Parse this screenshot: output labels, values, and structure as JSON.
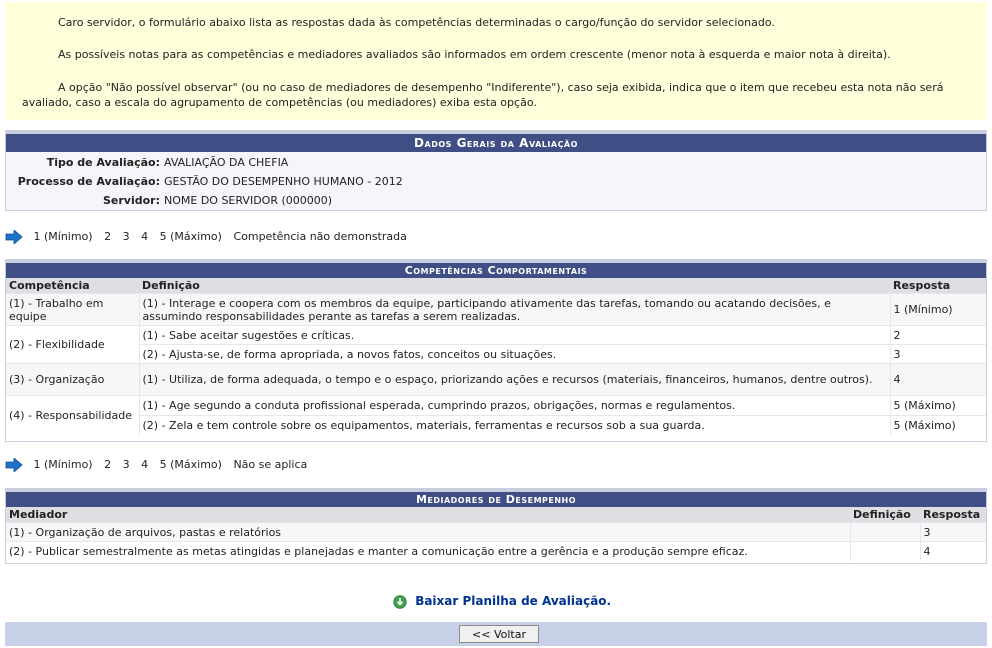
{
  "notice": {
    "p1": "Caro servidor, o formulário abaixo lista as respostas dada às competências determinadas o cargo/função do servidor selecionado.",
    "p2": "As possíveis notas para as competências e mediadores avaliados são informados em ordem crescente (menor nota à esquerda e maior nota à direita).",
    "p3": "A opção \"Não possível observar\" (ou no caso de mediadores de desempenho \"Indiferente\"), caso seja exibida, indica que o item que recebeu esta nota não será avaliado, caso a escala do agrupamento de competências (ou mediadores) exiba esta opção."
  },
  "dados": {
    "title": "Dados Gerais da Avaliação",
    "tipo_label": "Tipo de Avaliação:",
    "tipo_value": "AVALIAÇÃO DA CHEFIA",
    "processo_label": "Processo de Avaliação:",
    "processo_value": "GESTÃO DO DESEMPENHO HUMANO - 2012",
    "servidor_label": "Servidor:",
    "servidor_value": "NOME DO SERVIDOR (000000)"
  },
  "legend1": {
    "items": [
      "1 (Mínimo)",
      "2",
      "3",
      "4",
      "5 (Máximo)",
      "Competência não demonstrada"
    ]
  },
  "competencias": {
    "title": "Competências Comportamentais",
    "headers": {
      "competencia": "Competência",
      "definicao": "Definição",
      "resposta": "Resposta"
    },
    "groups": [
      {
        "name": "(1) - Trabalho em equipe",
        "items": [
          {
            "def": "(1) - Interage e coopera com os membros da equipe, participando ativamente das tarefas, tomando ou acatando decisões, e assumindo responsabilidades perante as tarefas a serem realizadas.",
            "resp": "1 (Mínimo)"
          }
        ]
      },
      {
        "name": "(2) - Flexibilidade",
        "items": [
          {
            "def": "(1) - Sabe aceitar sugestões e críticas.",
            "resp": "2"
          },
          {
            "def": "(2) - Ajusta-se, de forma apropriada, a novos fatos, conceitos ou situações.",
            "resp": "3"
          }
        ]
      },
      {
        "name": "(3) - Organização",
        "items": [
          {
            "def": "(1) - Utiliza, de forma adequada, o tempo e o espaço, priorizando ações e recursos (materiais, financeiros, humanos, dentre outros).",
            "resp": "4"
          }
        ]
      },
      {
        "name": "(4) - Responsabilidade",
        "items": [
          {
            "def": "(1) - Age segundo a conduta profissional esperada, cumprindo prazos, obrigações, normas e regulamentos.",
            "resp": "5 (Máximo)"
          },
          {
            "def": "(2) - Zela e tem controle sobre os equipamentos, materiais, ferramentas e recursos sob a sua guarda.",
            "resp": "5 (Máximo)"
          }
        ]
      }
    ]
  },
  "legend2": {
    "items": [
      "1 (Mínimo)",
      "2",
      "3",
      "4",
      "5 (Máximo)",
      "Não se aplica"
    ]
  },
  "mediadores": {
    "title": "Mediadores de Desempenho",
    "headers": {
      "mediador": "Mediador",
      "definicao": "Definição",
      "resposta": "Resposta"
    },
    "rows": [
      {
        "mediador": "(1) - Organização de arquivos, pastas e relatórios",
        "definicao": "",
        "resposta": "3"
      },
      {
        "mediador": "(2) - Publicar semestralmente as metas atingidas e planejadas e manter a comunicação entre a gerência e a produção sempre eficaz.",
        "definicao": "",
        "resposta": "4"
      }
    ]
  },
  "download": {
    "label": "Baixar Planilha de Avaliação."
  },
  "footer": {
    "back_label": "<< Voltar"
  },
  "colors": {
    "caption_bg": "#3f4f85",
    "notice_bg": "#ffffdc",
    "footer_bg": "#c8d0e8",
    "link": "#003390",
    "arrow": "#1f72c7"
  },
  "icons": {
    "legend_arrow": "arrow-right-icon",
    "download": "download-icon"
  }
}
